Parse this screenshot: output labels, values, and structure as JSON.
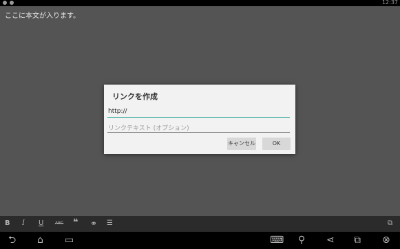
{
  "status_bar": {
    "time": "12:37"
  },
  "editor": {
    "body_text": "ここに本文が入ります。"
  },
  "dialog": {
    "title": "リンクを作成",
    "url_value": "http://",
    "link_text_placeholder": "リンクテキスト (オプション)",
    "cancel_label": "キャンセル",
    "ok_label": "OK"
  },
  "toolbar": {
    "bold": "B",
    "italic": "I",
    "underline": "U",
    "strikethrough": "ABC",
    "quote": "❝",
    "link": "⚭",
    "list": "☰",
    "expand": "⧉"
  },
  "navbar": {
    "back": "⮌",
    "home": "⌂",
    "recents": "▭",
    "keyboard": "⌨",
    "location": "⚲",
    "share": "⋖",
    "window": "⧉",
    "close": "⊗"
  },
  "colors": {
    "accent": "#2fa89a",
    "editor_bg": "#545454",
    "dialog_bg": "#f2f2f2"
  }
}
